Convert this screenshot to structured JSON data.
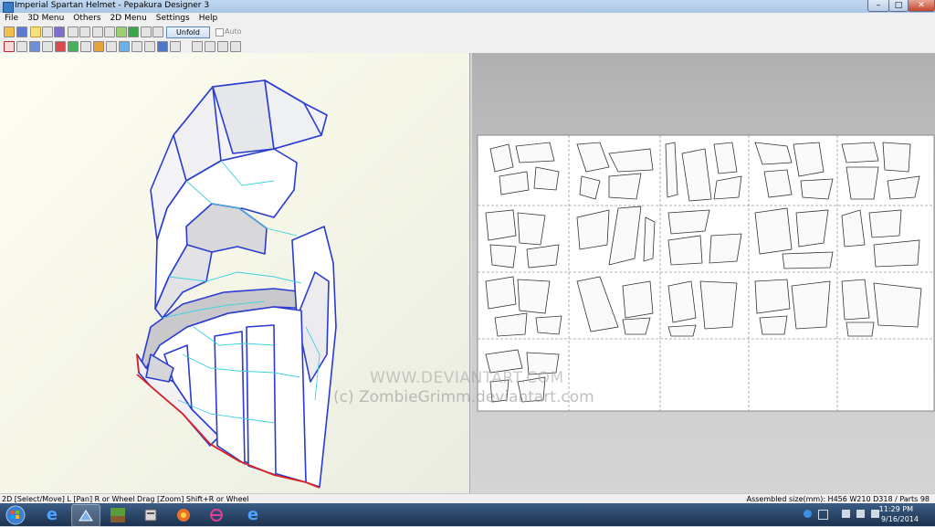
{
  "window": {
    "title": "Imperial Spartan Helmet - Pepakura Designer 3",
    "minimize": "–",
    "maximize": "□",
    "close": "✕"
  },
  "menu": [
    "File",
    "3D Menu",
    "Others",
    "2D Menu",
    "Settings",
    "Help"
  ],
  "toolbar": {
    "unfold_undo": "Unfold Undo",
    "auto_label": "Auto"
  },
  "status": {
    "left": "2D [Select/Move] L [Pan] R or Wheel Drag [Zoom] Shift+R or Wheel",
    "right": "Assembled size(mm): H456 W210 D318 / Parts 98"
  },
  "watermark": {
    "url": "WWW.DEVIANTART.COM",
    "copyright": "(c) ZombieGrimm.deviantart.com",
    "logo_text": "deviant"
  },
  "taskbar": {
    "time": "11:29 PM",
    "date": "9/16/2014",
    "apps": [
      "start-orb-icon",
      "ie-icon",
      "pepakura-icon",
      "minecraft-icon",
      "server-icon",
      "paint-icon",
      "network-icon",
      "ie-icon"
    ]
  },
  "colors": {
    "mesh_edge": "#2a3bd0",
    "fold_line": "#3fd0e0",
    "cut_edge": "#e02020",
    "sheet_bg": "#ffffff"
  }
}
